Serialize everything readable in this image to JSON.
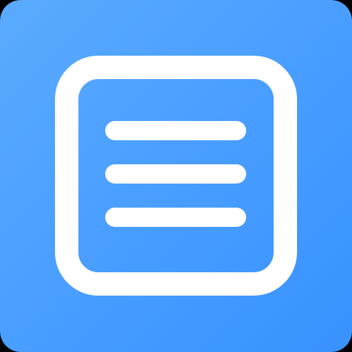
{
  "icon": {
    "name": "menu-list-icon",
    "colors": {
      "gradient_start": "#5AABFF",
      "gradient_end": "#3891FF",
      "frame": "#FFFFFF",
      "lines": "#FFFFFF"
    },
    "line_count": 3
  }
}
